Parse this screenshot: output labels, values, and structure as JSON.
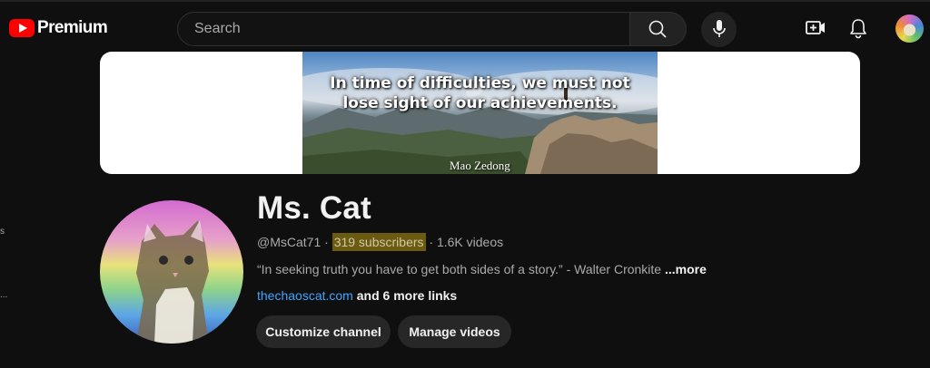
{
  "logo": {
    "text": "Premium"
  },
  "search": {
    "placeholder": "Search"
  },
  "icons": {
    "search": "search-icon",
    "mic": "mic-icon",
    "create": "create-video-icon",
    "notifications": "bell-icon"
  },
  "banner": {
    "quote_line1": "In time of difficulties, we must not",
    "quote_line2": "lose sight of our achievements.",
    "author": "Mao Zedong"
  },
  "left_rail": {
    "item_a": "s",
    "item_b": "..."
  },
  "channel": {
    "name": "Ms. Cat",
    "handle": "@MsCat71",
    "separator": "·",
    "subscribers": "319 subscribers",
    "videos": "1.6K videos",
    "description": "“In seeking truth you have to get both sides of a story.” - Walter Cronkite",
    "more": "...more",
    "link": "thechaoscat.com",
    "more_links": "and 6 more links"
  },
  "actions": {
    "customize": "Customize channel",
    "manage": "Manage videos"
  },
  "colors": {
    "background": "#0f0f0f",
    "brand_red": "#ff0000",
    "link": "#3ea6ff",
    "highlight": "#6b5b10",
    "button": "#272727"
  }
}
